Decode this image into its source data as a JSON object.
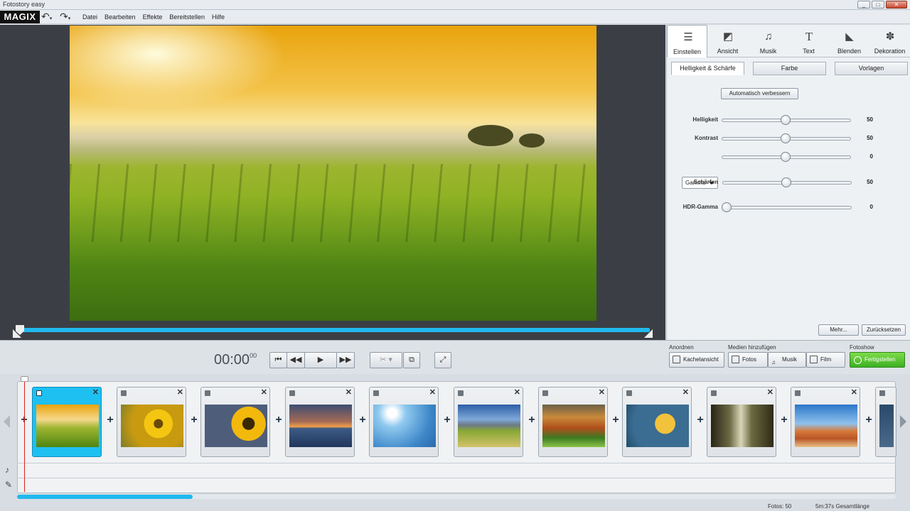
{
  "window": {
    "title": "Fotostory easy",
    "controls": [
      "_",
      "□",
      "✕"
    ]
  },
  "menubar": {
    "logo": "MAGIX",
    "undo_icon": "undo-icon",
    "redo_icon": "redo-icon",
    "items": [
      "Datei",
      "Bearbeiten",
      "Effekte",
      "Bereitstellen",
      "Hilfe"
    ]
  },
  "tool_tabs": [
    {
      "label": "Einstellen",
      "icon": "sliders-icon",
      "glyph": "☰",
      "active": true
    },
    {
      "label": "Ansicht",
      "icon": "ansicht-icon",
      "glyph": "◩"
    },
    {
      "label": "Musik",
      "icon": "music-note-icon",
      "glyph": "♫"
    },
    {
      "label": "Text",
      "icon": "text-icon",
      "glyph": "T"
    },
    {
      "label": "Blenden",
      "icon": "blenden-icon",
      "glyph": "◣"
    },
    {
      "label": "Dekoration",
      "icon": "dekoration-icon",
      "glyph": "✽"
    }
  ],
  "sub_tabs": [
    {
      "label": "Helligkeit & Schärfe",
      "active": true
    },
    {
      "label": "Farbe"
    },
    {
      "label": "Vorlagen"
    }
  ],
  "auto_button": "Automatisch verbessern",
  "sliders": [
    {
      "label": "Helligkeit",
      "value": "50",
      "position": 0.5
    },
    {
      "label": "Kontrast",
      "value": "50",
      "position": 0.5
    },
    {
      "label": "Gamma",
      "value": "0",
      "position": 0.5,
      "is_select": true
    },
    {
      "label": "Schärfen",
      "value": "50",
      "position": 0.5
    },
    {
      "label": "HDR-Gamma",
      "value": "0",
      "position": 0.0
    }
  ],
  "panel_buttons": {
    "more": "Mehr...",
    "reset": "Zurücksetzen"
  },
  "transport": {
    "timecode": "00:00",
    "timecode_frames": "00",
    "buttons": [
      "skip-start-icon",
      "rewind-icon",
      "play-icon",
      "fast-forward-icon",
      "scissors-icon",
      "split-icon",
      "fullscreen-icon"
    ]
  },
  "groups": {
    "anordnen": {
      "title": "Anordnen",
      "kachel": "Kachelansicht"
    },
    "medien": {
      "title": "Medien hinzufügen",
      "fotos": "Fotos",
      "musik": "Musik",
      "film": "Film"
    },
    "fotoshow": {
      "title": "Fotoshow",
      "fertig": "Fertigstellen"
    }
  },
  "storyboard": {
    "thumbnails": [
      {
        "name": "vineyard",
        "selected": true
      },
      {
        "name": "sunflowers-1"
      },
      {
        "name": "sunflowers-2"
      },
      {
        "name": "sunset-sea"
      },
      {
        "name": "daisies-sky"
      },
      {
        "name": "mountain-meadow"
      },
      {
        "name": "autumn-trees"
      },
      {
        "name": "yellow-tree"
      },
      {
        "name": "forest-rays"
      },
      {
        "name": "red-rocks"
      },
      {
        "name": "partial"
      }
    ],
    "scroll_progress": 0.2
  },
  "status": {
    "photos": "Fotos: 50",
    "length": "5m:37s Gesamtlänge"
  }
}
